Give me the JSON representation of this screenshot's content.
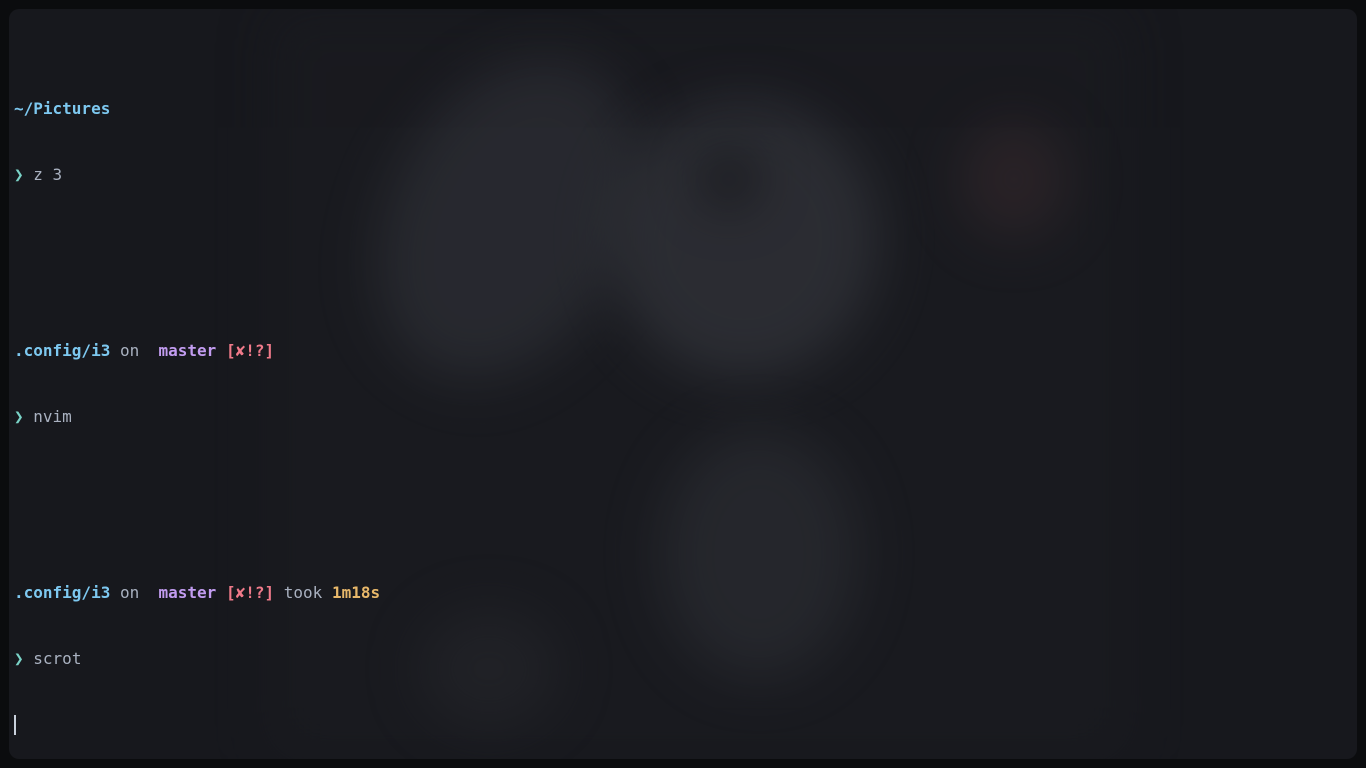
{
  "colors": {
    "dir": "#7dc8f0",
    "prompt": "#7ad3c7",
    "branch": "#c29cf0",
    "status": "#f07a8a",
    "duration": "#e8b86a",
    "text": "#a9b1c0",
    "cursor": "#c9d1dc"
  },
  "icons": {
    "prompt_symbol": "❯",
    "branch_icon": "branch-icon"
  },
  "terminal": {
    "blocks": [
      {
        "dir": "~/Pictures",
        "prompt": "❯",
        "command": "z 3"
      },
      {
        "dir": ".config/i3",
        "on": "on",
        "branch_symbol": "",
        "branch": "master",
        "status": "[✘!?]",
        "prompt": "❯",
        "command": "nvim"
      },
      {
        "dir": ".config/i3",
        "on": "on",
        "branch_symbol": "",
        "branch": "master",
        "status": "[✘!?]",
        "took_label": "took",
        "duration": "1m18s",
        "prompt": "❯",
        "command": "scrot"
      }
    ]
  }
}
